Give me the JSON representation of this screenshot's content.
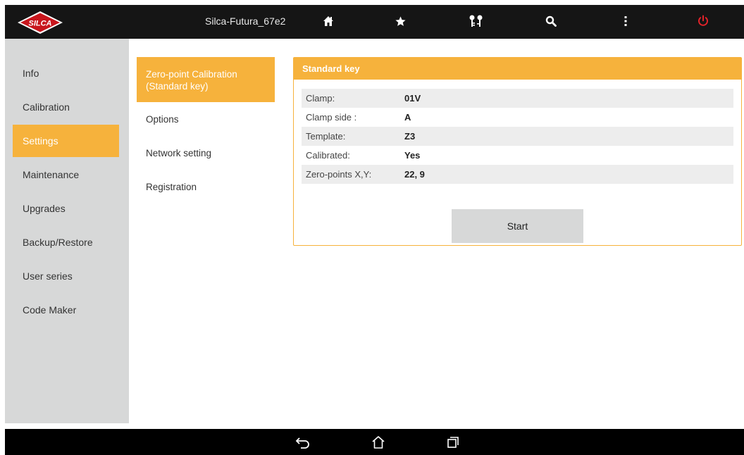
{
  "app": {
    "device_name": "Silca-Futura_67e2",
    "accent_color": "#f6b23c",
    "topbar_icons": [
      "home-icon",
      "star-icon",
      "keys-icon",
      "search-icon",
      "more-vertical-icon",
      "power-icon"
    ]
  },
  "sidebar": {
    "items": [
      {
        "label": "Info"
      },
      {
        "label": "Calibration"
      },
      {
        "label": "Settings",
        "active": true
      },
      {
        "label": "Maintenance"
      },
      {
        "label": "Upgrades"
      },
      {
        "label": "Backup/Restore"
      },
      {
        "label": "User series"
      },
      {
        "label": "Code Maker"
      }
    ]
  },
  "submenu": {
    "items": [
      {
        "label_line1": "Zero-point Calibration",
        "label_line2": "(Standard key)",
        "active": true
      },
      {
        "label": "Options"
      },
      {
        "label": "Network setting"
      },
      {
        "label": "Registration"
      }
    ]
  },
  "panel": {
    "title": "Standard key",
    "rows": [
      {
        "key": "Clamp:",
        "value": "01V"
      },
      {
        "key": "Clamp side :",
        "value": "A"
      },
      {
        "key": "Template:",
        "value": "Z3"
      },
      {
        "key": "Calibrated:",
        "value": "Yes"
      },
      {
        "key": "Zero-points X,Y:",
        "value": "22, 9"
      }
    ],
    "start_label": "Start"
  },
  "navbar": {
    "icons": [
      "back-icon",
      "home-outline-icon",
      "recent-apps-icon"
    ]
  }
}
